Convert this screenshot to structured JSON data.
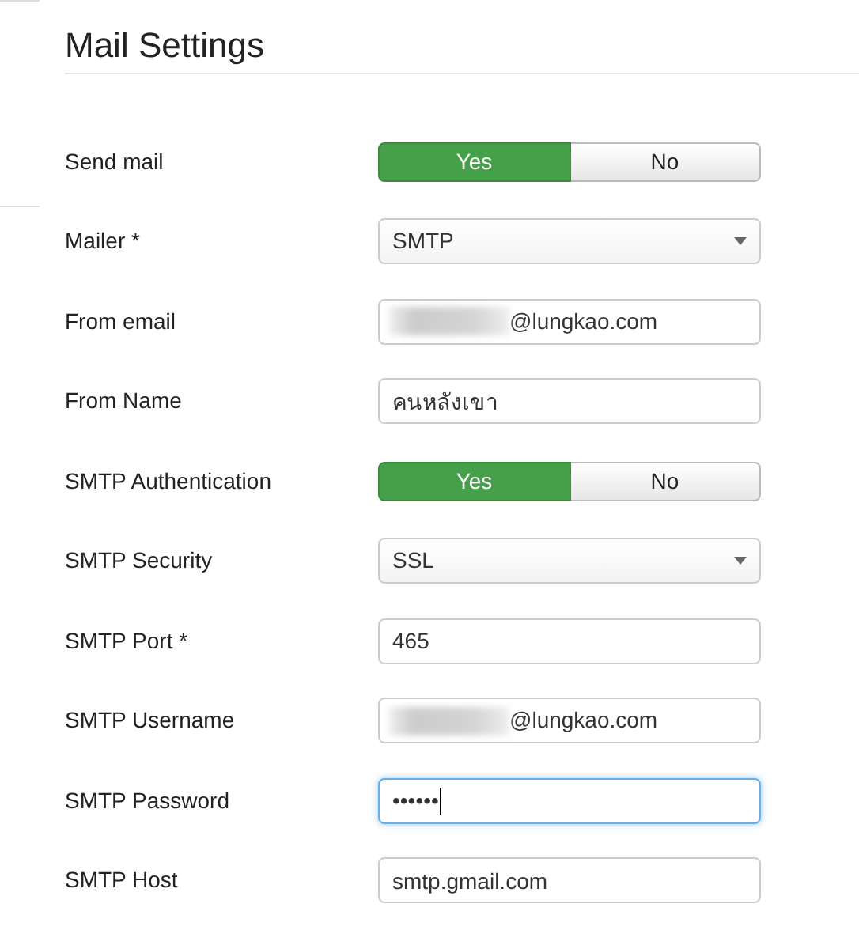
{
  "title": "Mail Settings",
  "fields": [
    {
      "kind": "toggle",
      "label": "Send mail",
      "options": [
        {
          "label": "Yes",
          "selected": true
        },
        {
          "label": "No",
          "selected": false
        }
      ]
    },
    {
      "kind": "select",
      "label": "Mailer *",
      "value": "SMTP"
    },
    {
      "kind": "text",
      "label": "From email",
      "value": "@lungkao.com",
      "redacted": true
    },
    {
      "kind": "text",
      "label": "From Name",
      "value": "คนหลังเขา"
    },
    {
      "kind": "toggle",
      "label": "SMTP Authentication",
      "options": [
        {
          "label": "Yes",
          "selected": true
        },
        {
          "label": "No",
          "selected": false
        }
      ]
    },
    {
      "kind": "select",
      "label": "SMTP Security",
      "value": "SSL"
    },
    {
      "kind": "text",
      "label": "SMTP Port *",
      "value": "465"
    },
    {
      "kind": "text",
      "label": "SMTP Username",
      "value": "@lungkao.com",
      "redacted": true
    },
    {
      "kind": "text",
      "label": "SMTP Password",
      "value": "••••••",
      "focused": true
    },
    {
      "kind": "text",
      "label": "SMTP Host",
      "value": "smtp.gmail.com"
    }
  ]
}
